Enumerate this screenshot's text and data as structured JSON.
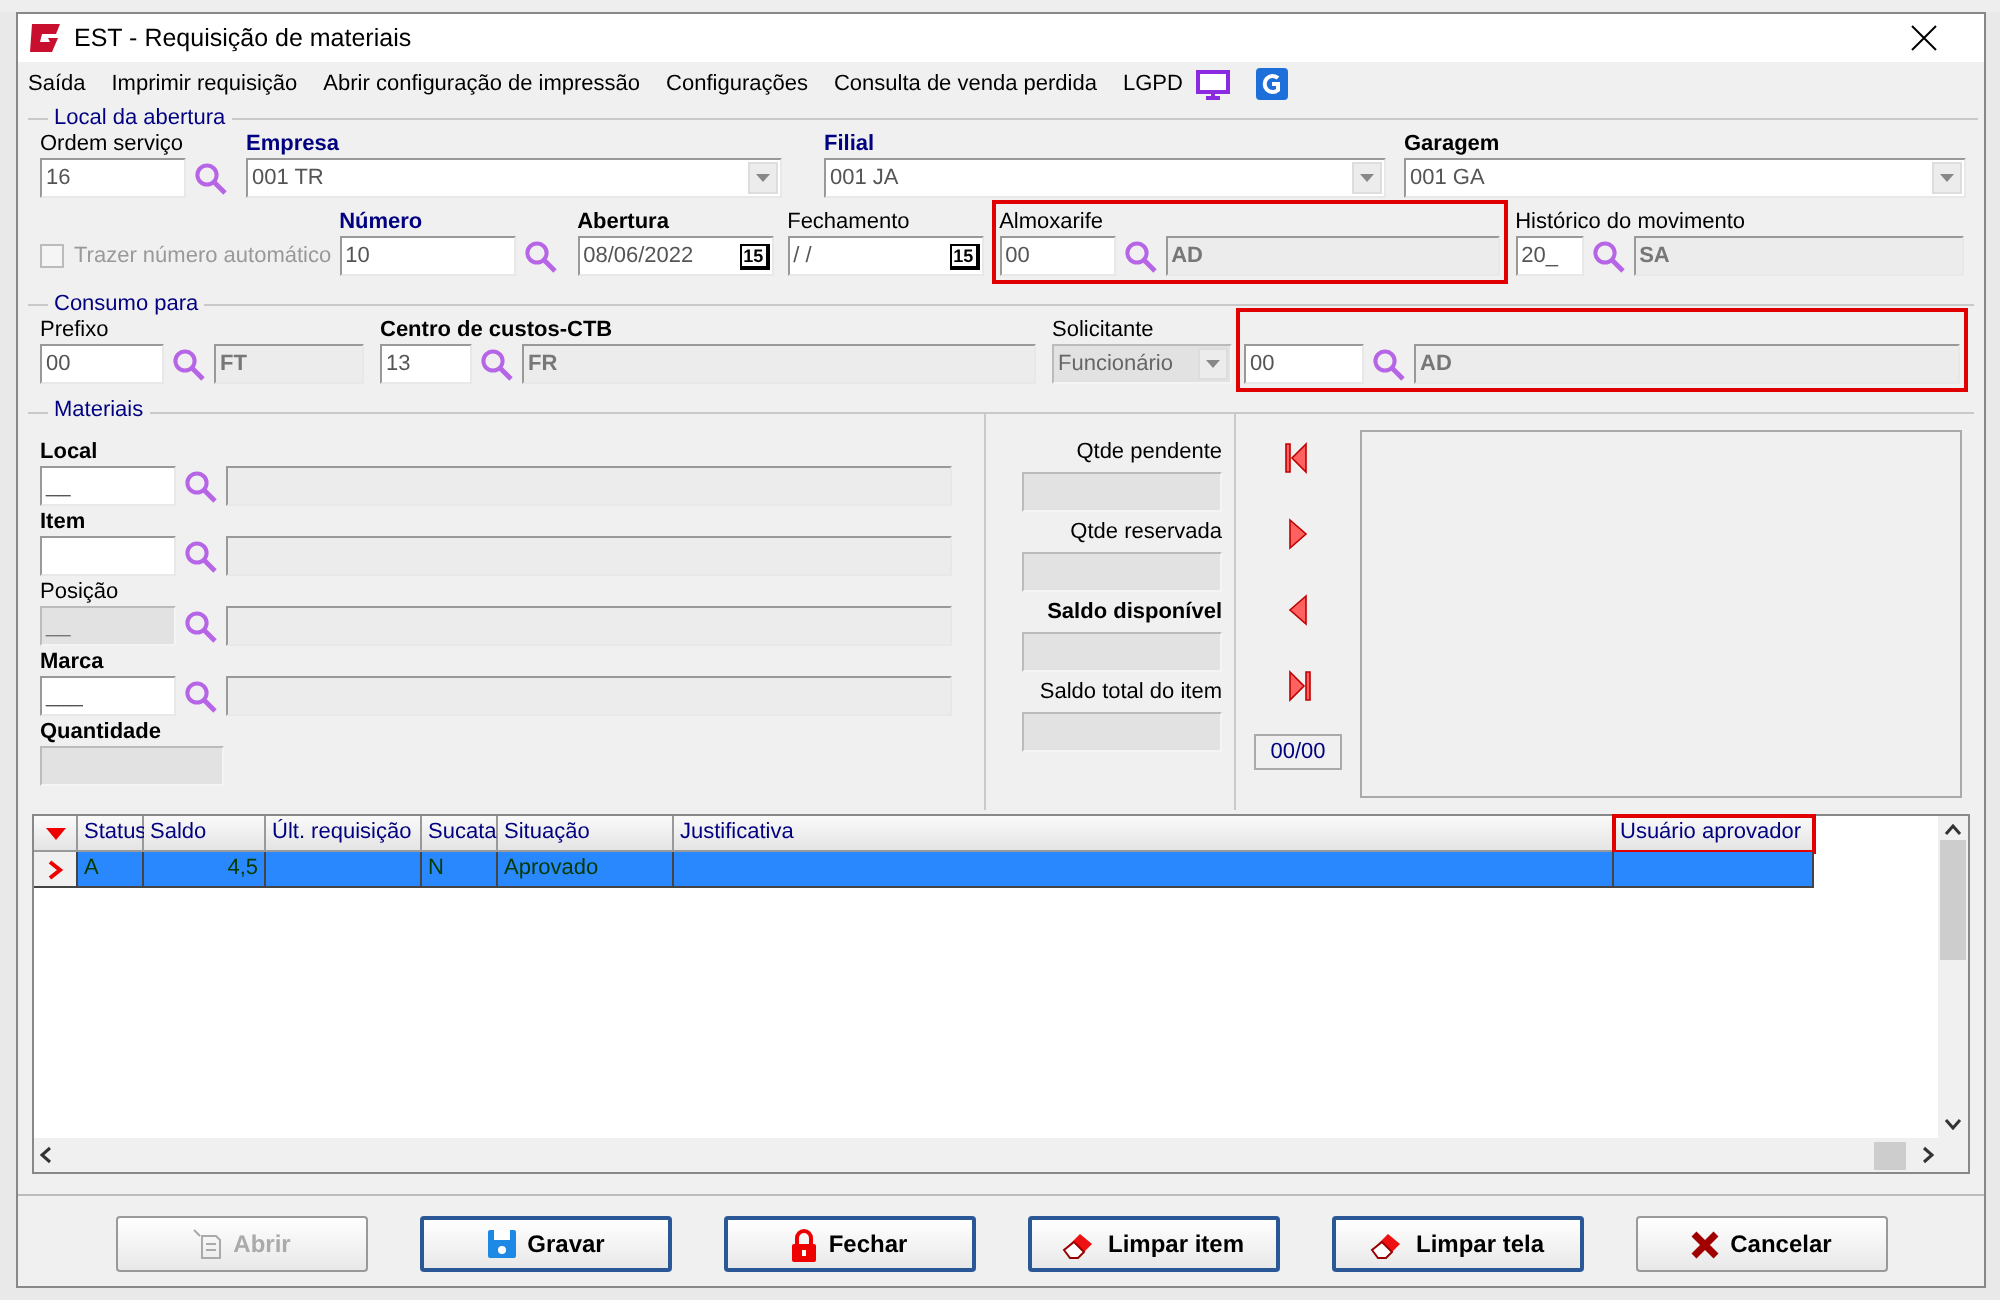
{
  "window": {
    "title": "EST - Requisição de materiais"
  },
  "menu": [
    {
      "label": "Saída"
    },
    {
      "label": "Imprimir requisição"
    },
    {
      "label": "Abrir configuração de impressão"
    },
    {
      "label": "Configurações"
    },
    {
      "label": "Consulta de venda perdida"
    },
    {
      "label": "LGPD"
    }
  ],
  "local_da_abertura": {
    "legend": "Local da abertura",
    "row_1": [
      {
        "kind": "lookup",
        "label": "Ordem serviço",
        "bold": false,
        "navy": false,
        "code": "16"
      },
      {
        "kind": "combo",
        "label": "Empresa",
        "bold": true,
        "navy": true,
        "value": "001 TR"
      },
      {
        "kind": "combo",
        "label": "Filial",
        "bold": true,
        "navy": true,
        "value": "001 JA"
      },
      {
        "kind": "combo",
        "label": "Garagem",
        "bold": true,
        "navy": false,
        "value": "001 GA"
      }
    ],
    "auto_number": {
      "label": "Trazer número automático",
      "checked": false,
      "disabled": true
    },
    "row_2": [
      {
        "kind": "lookup",
        "label": "Número",
        "bold": true,
        "navy": true,
        "code": "10"
      },
      {
        "kind": "date",
        "label": "Abertura",
        "bold": true,
        "navy": false,
        "value": "08/06/2022",
        "button_text": "15"
      },
      {
        "kind": "date",
        "label": "Fechamento",
        "bold": false,
        "navy": false,
        "value": " / /",
        "button_text": "15"
      },
      {
        "kind": "lookup",
        "label": "Almoxarife",
        "bold": false,
        "navy": false,
        "code": "00",
        "name": "AD",
        "highlighted": true
      },
      {
        "kind": "lookup",
        "label": "Histórico do movimento",
        "bold": false,
        "navy": false,
        "code": "20_",
        "name": "SA",
        "highlighted": false
      }
    ]
  },
  "consumo_para": {
    "legend": "Consumo para",
    "fields": [
      {
        "kind": "lookup",
        "label": "Prefixo",
        "bold": false,
        "navy": false,
        "code": "00",
        "name": "FT",
        "highlighted": false
      },
      {
        "kind": "lookup",
        "label": "Centro de custos-CTB",
        "bold": true,
        "navy": false,
        "code": "13",
        "name": "FR",
        "highlighted": false
      },
      {
        "kind": "combo",
        "label": "Solicitante",
        "bold": false,
        "navy": false,
        "value": "Funcionário",
        "disabled": true
      },
      {
        "kind": "lookup",
        "code": "00",
        "name": "AD",
        "highlighted": true
      }
    ]
  },
  "materiais": {
    "legend": "Materiais",
    "fields": [
      {
        "kind": "lookup",
        "label": "Local",
        "bold": true,
        "navy": false,
        "code": "__",
        "disabled": false
      },
      {
        "kind": "lookup",
        "label": "Item",
        "bold": true,
        "navy": false,
        "disabled": false
      },
      {
        "kind": "lookup",
        "label": "Posição",
        "bold": false,
        "navy": false,
        "code": "__",
        "disabled": true
      },
      {
        "kind": "lookup",
        "label": "Marca",
        "bold": true,
        "navy": false,
        "code": "___",
        "disabled": false
      },
      {
        "kind": "text",
        "label": "Quantidade",
        "bold": true,
        "navy": false,
        "disabled": true
      }
    ],
    "quantities": [
      {
        "label": "Qtde pendente",
        "bold": false
      },
      {
        "label": "Qtde reservada",
        "bold": false
      },
      {
        "label": "Saldo disponível",
        "bold": true
      },
      {
        "label": "Saldo total do item",
        "bold": false
      }
    ],
    "navigation": [
      {
        "kind": "first"
      },
      {
        "kind": "next"
      },
      {
        "kind": "previous"
      },
      {
        "kind": "last"
      }
    ],
    "counter": "00/00"
  },
  "grid": {
    "columns": [
      {
        "label": "Status",
        "highlighted": false
      },
      {
        "label": "Saldo",
        "highlighted": false
      },
      {
        "label": "Últ. requisição",
        "highlighted": false
      },
      {
        "label": "Sucata",
        "highlighted": false
      },
      {
        "label": "Situação",
        "highlighted": false
      },
      {
        "label": "Justificativa",
        "highlighted": false
      },
      {
        "label": "Usuário aprovador",
        "highlighted": true
      }
    ],
    "rows": [
      {
        "selected": true,
        "cells": [
          "A",
          "4,5",
          null,
          "N",
          "Aprovado",
          null,
          null
        ]
      }
    ]
  },
  "buttons": [
    {
      "label": "Abrir",
      "disabled": true,
      "focused": false
    },
    {
      "label": "Gravar",
      "disabled": false,
      "focused": true
    },
    {
      "label": "Fechar",
      "disabled": false,
      "focused": true
    },
    {
      "label": "Limpar item",
      "disabled": false,
      "focused": true
    },
    {
      "label": "Limpar tela",
      "disabled": false,
      "focused": true
    },
    {
      "label": "Cancelar",
      "disabled": false,
      "focused": false
    }
  ]
}
